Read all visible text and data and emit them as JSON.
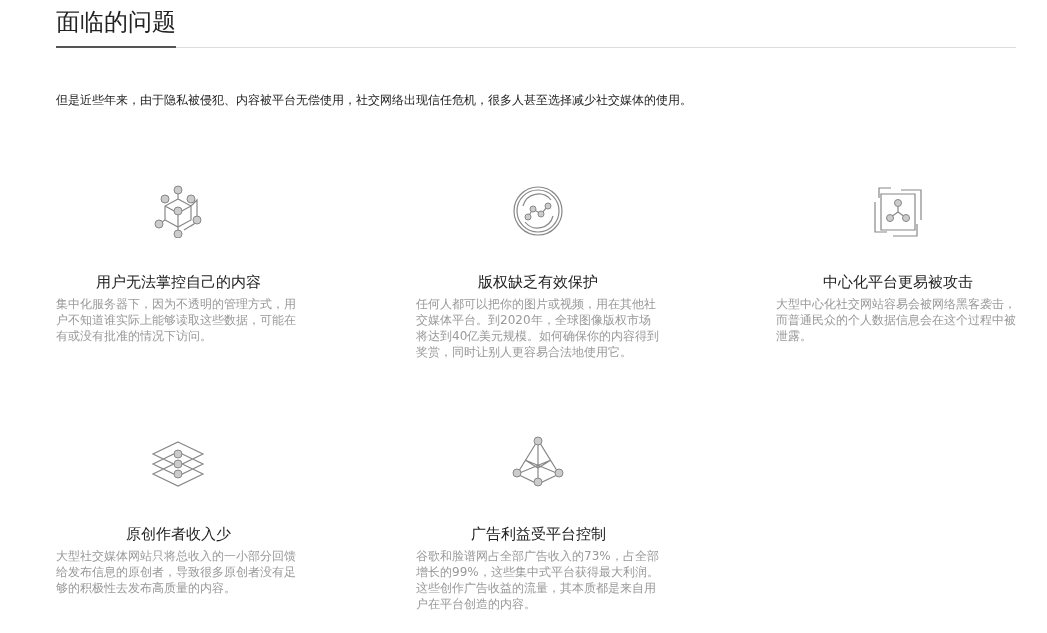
{
  "heading": "面临的问题",
  "intro": "但是近些年来，由于隐私被侵犯、内容被平台无偿使用，社交网络出现信任危机，很多人甚至选择减少社交媒体的使用。",
  "problems": [
    {
      "title": "用户无法掌控自己的内容",
      "text": "集中化服务器下，因为不透明的管理方式，用户不知道谁实际上能够读取这些数据，可能在有或没有批准的情况下访问。"
    },
    {
      "title": "版权缺乏有效保护",
      "text": "任何人都可以把你的图片或视频，用在其他社交媒体平台。到2020年，全球图像版权市场将达到40亿美元规模。如何确保你的内容得到奖赏，同时让别人更容易合法地使用它。"
    },
    {
      "title": "中心化平台更易被攻击",
      "text": "大型中心化社交网站容易会被网络黑客袭击，而普通民众的个人数据信息会在这个过程中被泄露。"
    },
    {
      "title": "原创作者收入少",
      "text": "大型社交媒体网站只将总收入的一小部分回馈给发布信息的原创者，导致很多原创者没有足够的积极性去发布高质量的内容。"
    },
    {
      "title": "广告利益受平台控制",
      "text": "谷歌和脸谱网占全部广告收入的73%，占全部增长的99%，这些集中式平台获得最大利润。这些创作广告收益的流量，其本质都是来自用户在平台创造的内容。"
    }
  ]
}
